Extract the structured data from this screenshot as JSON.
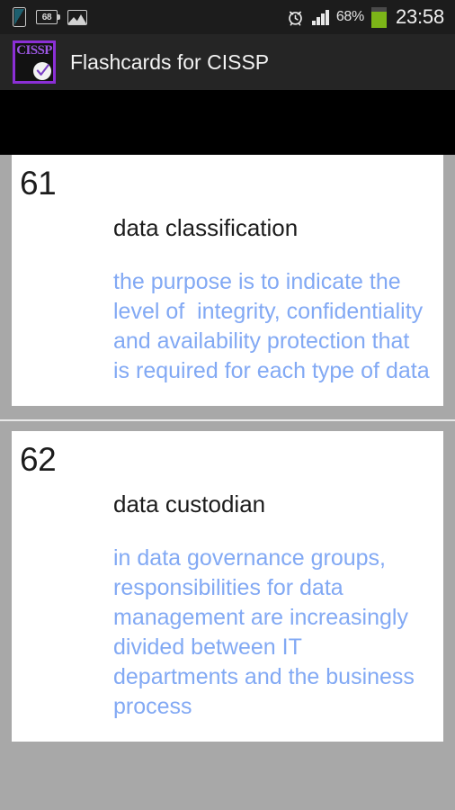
{
  "status_bar": {
    "left_icons": [
      {
        "name": "screen-cast-icon",
        "label": ""
      },
      {
        "name": "battery-number-badge-icon",
        "label": "68"
      },
      {
        "name": "gallery-picture-icon",
        "label": ""
      }
    ],
    "alarm_icon": "alarm-clock-icon",
    "signal_icon": "signal-bars-icon",
    "battery_percent": "68%",
    "battery_icon": "battery-icon",
    "clock": "23:58"
  },
  "action_bar": {
    "app_icon_text": "CISSP",
    "app_icon_name": "app-icon-cissp",
    "title": "Flashcards for CISSP"
  },
  "cards": [
    {
      "number": "61",
      "term": "data classification",
      "definition": "the purpose is to indicate the level of  integrity, confidentiality and availability protection that is required for each type of data"
    },
    {
      "number": "62",
      "term": "data custodian",
      "definition": "in data governance groups, responsibilities for data management are increasingly divided between IT departments and the business process"
    }
  ],
  "colors": {
    "status_bar_bg": "#1c1c1c",
    "action_bar_bg": "#252525",
    "list_bg": "#a8a8a8",
    "card_bg": "#ffffff",
    "definition_blue": "#82a9f4",
    "accent_purple": "#8b2fd6",
    "battery_green": "#7cb518"
  }
}
